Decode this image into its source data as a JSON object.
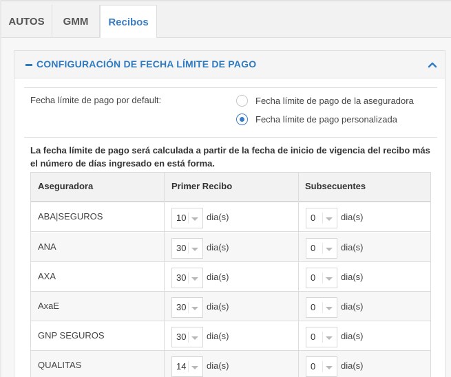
{
  "tabs": [
    {
      "label": "AUTOS",
      "active": false
    },
    {
      "label": "GMM",
      "active": false
    },
    {
      "label": "Recibos",
      "active": true
    }
  ],
  "panel": {
    "title": "CONFIGURACIÓN DE FECHA LÍMITE DE PAGO",
    "collapse_icon": "minus-icon",
    "toggle_icon": "chevron-up-icon"
  },
  "default_due": {
    "label": "Fecha límite de pago por default:",
    "options": [
      {
        "label": "Fecha límite de pago de la aseguradora",
        "checked": false
      },
      {
        "label": "Fecha límite de pago personalizada",
        "checked": true
      }
    ]
  },
  "note": "La fecha límite de pago será calculada a partir de la fecha de inicio de vigencia del recibo más el número de días ingresado en está forma.",
  "table": {
    "headers": [
      "Aseguradora",
      "Primer Recibo",
      "Subsecuentes"
    ],
    "unit": "dia(s)",
    "rows": [
      {
        "name": "ABA|SEGUROS",
        "first": "10",
        "subsequent": "0"
      },
      {
        "name": "ANA",
        "first": "30",
        "subsequent": "0"
      },
      {
        "name": "AXA",
        "first": "30",
        "subsequent": "0"
      },
      {
        "name": "AxaE",
        "first": "30",
        "subsequent": "0"
      },
      {
        "name": "GNP SEGUROS",
        "first": "30",
        "subsequent": "0"
      },
      {
        "name": "QUALITAS",
        "first": "14",
        "subsequent": "0"
      }
    ]
  },
  "colors": {
    "accent": "#2f7bc1",
    "tab_active_text": "#3b7dc4"
  }
}
